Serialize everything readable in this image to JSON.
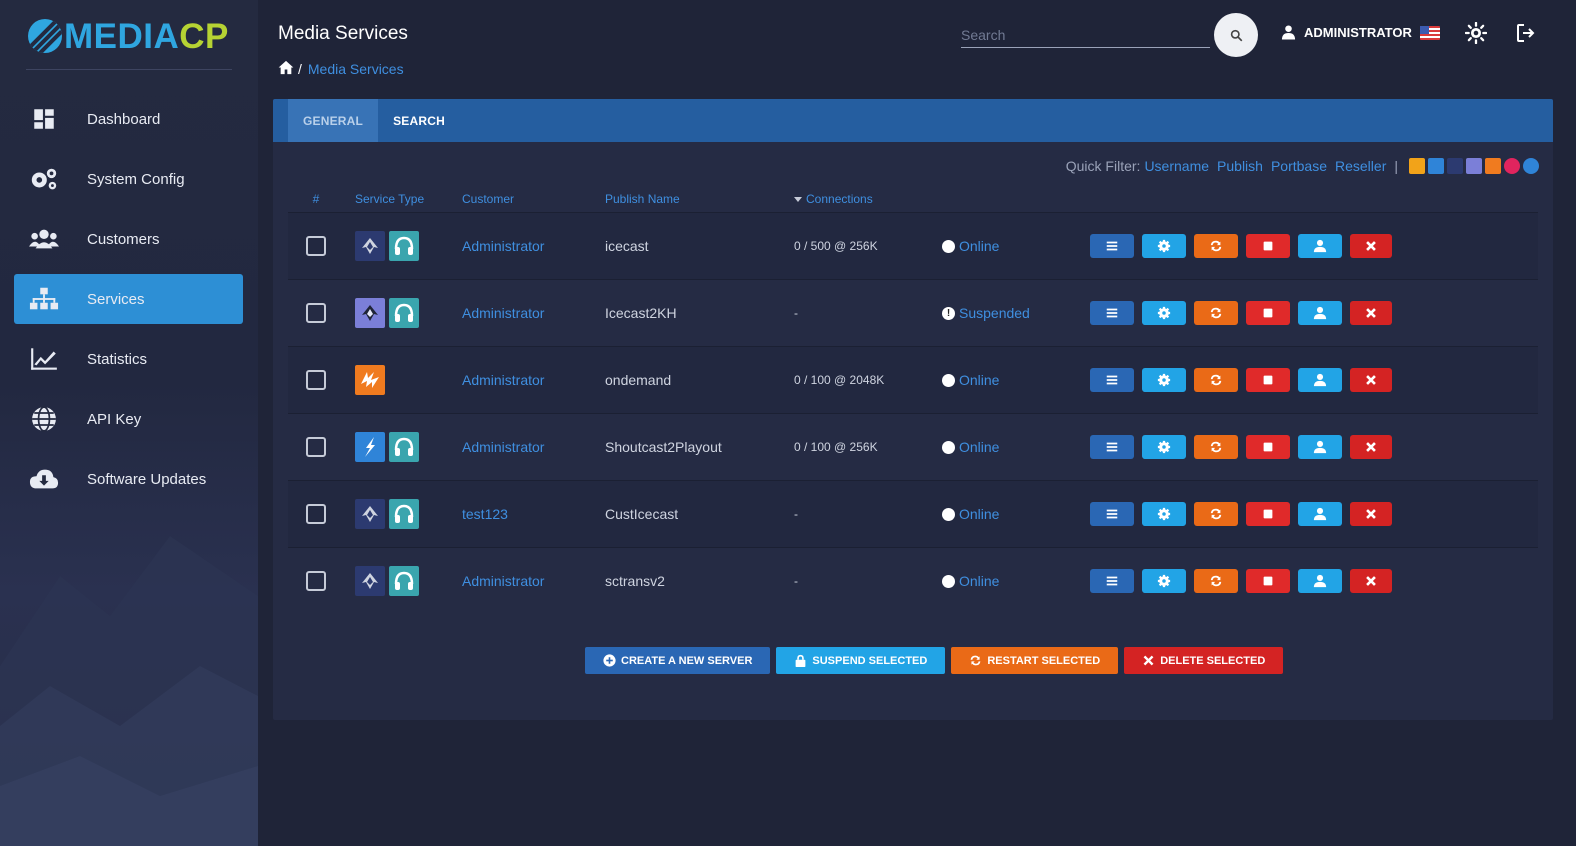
{
  "brand": {
    "name_part1": "MEDIA",
    "name_part2": "CP"
  },
  "sidebar": {
    "items": [
      {
        "label": "Dashboard",
        "icon": "dashboard-icon",
        "active": false
      },
      {
        "label": "System Config",
        "icon": "gears-icon",
        "active": false
      },
      {
        "label": "Customers",
        "icon": "users-icon",
        "active": false
      },
      {
        "label": "Services",
        "icon": "sitemap-icon",
        "active": true
      },
      {
        "label": "Statistics",
        "icon": "chart-line-icon",
        "active": false
      },
      {
        "label": "API Key",
        "icon": "globe-icon",
        "active": false
      },
      {
        "label": "Software Updates",
        "icon": "cloud-download-icon",
        "active": false
      }
    ]
  },
  "header": {
    "title": "Media Services",
    "breadcrumb": {
      "separator": "/",
      "current": "Media Services"
    },
    "search_placeholder": "Search",
    "user": "ADMINISTRATOR"
  },
  "tabs": [
    {
      "label": "GENERAL",
      "active": true
    },
    {
      "label": "SEARCH",
      "active": false
    }
  ],
  "quick_filter": {
    "label": "Quick Filter:",
    "links": [
      "Username",
      "Publish",
      "Portbase",
      "Reseller"
    ],
    "separator": "|"
  },
  "table": {
    "columns": [
      "#",
      "Service Type",
      "Customer",
      "Publish Name",
      "Connections"
    ],
    "rows": [
      {
        "types": [
          "icecast",
          "headphones"
        ],
        "customer": "Administrator",
        "publish": "icecast",
        "connections": "0 / 500 @ 256K",
        "status": "Online",
        "status_kind": "online"
      },
      {
        "types": [
          "icecast-kh",
          "headphones"
        ],
        "customer": "Administrator",
        "publish": "Icecast2KH",
        "connections": "-",
        "status": "Suspended",
        "status_kind": "suspended"
      },
      {
        "types": [
          "wowza"
        ],
        "customer": "Administrator",
        "publish": "ondemand",
        "connections": "0 / 100 @ 2048K",
        "status": "Online",
        "status_kind": "online"
      },
      {
        "types": [
          "shoutcast",
          "headphones"
        ],
        "customer": "Administrator",
        "publish": "Shoutcast2Playout",
        "connections": "0 / 100 @ 256K",
        "status": "Online",
        "status_kind": "online"
      },
      {
        "types": [
          "icecast",
          "headphones"
        ],
        "customer": "test123",
        "publish": "CustIcecast",
        "connections": "-",
        "status": "Online",
        "status_kind": "online"
      },
      {
        "types": [
          "icecast",
          "headphones"
        ],
        "customer": "Administrator",
        "publish": "sctransv2",
        "connections": "-",
        "status": "Online",
        "status_kind": "online"
      }
    ]
  },
  "bulk_actions": {
    "create": "CREATE A NEW SERVER",
    "suspend": "SUSPEND SELECTED",
    "restart": "RESTART SELECTED",
    "delete": "DELETE SELECTED"
  },
  "colors": {
    "accent": "#2d8fd5",
    "link": "#3f8fe0",
    "tabbar": "#255ea0",
    "restart": "#ea6a17",
    "danger": "#d42323"
  }
}
